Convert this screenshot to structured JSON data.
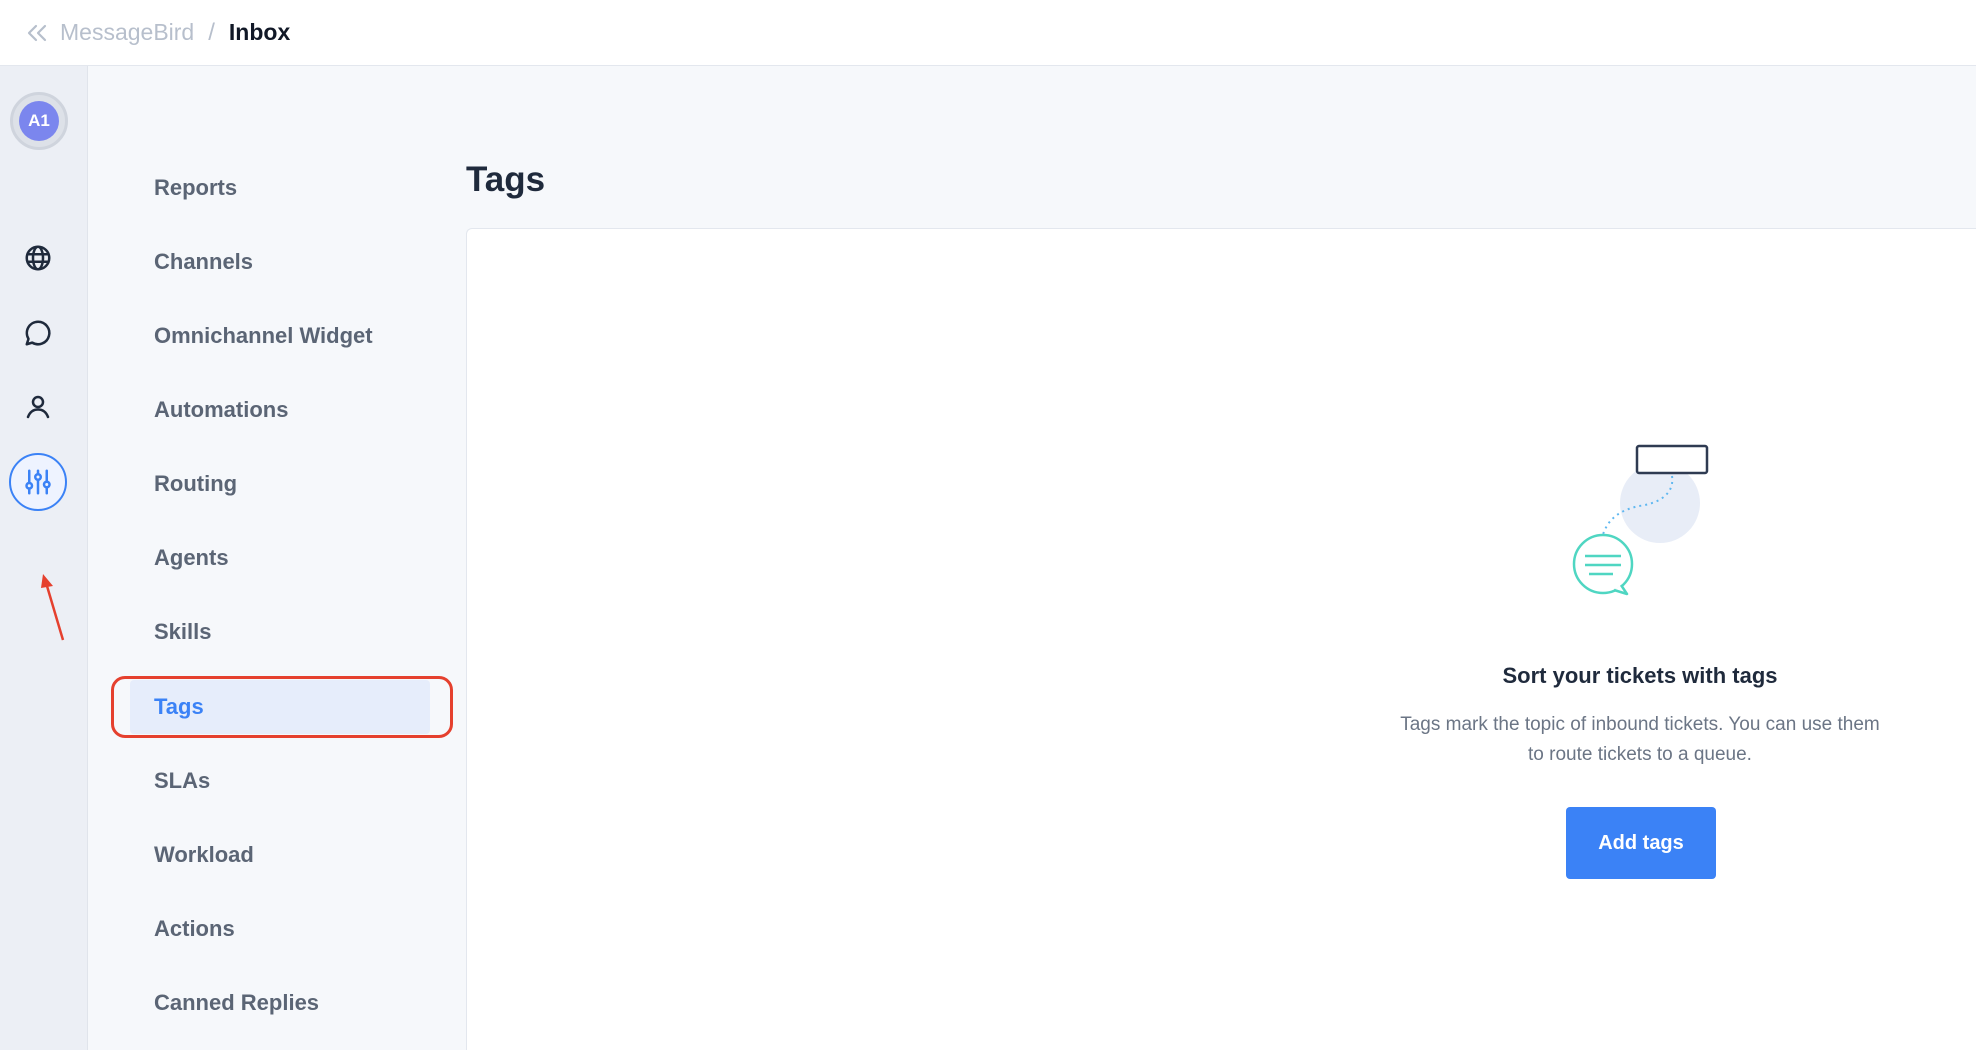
{
  "header": {
    "back_icon": "double-chevron-left-icon",
    "parent_crumb": "MessageBird",
    "separator": "/",
    "current_crumb": "Inbox"
  },
  "rail": {
    "avatar_initials": "A1",
    "items": [
      {
        "icon": "globe-icon"
      },
      {
        "icon": "chat-bubble-icon"
      },
      {
        "icon": "person-icon"
      },
      {
        "icon": "sliders-icon",
        "active": true
      }
    ]
  },
  "nav": {
    "items": [
      {
        "label": "Reports"
      },
      {
        "label": "Channels"
      },
      {
        "label": "Omnichannel Widget"
      },
      {
        "label": "Automations"
      },
      {
        "label": "Routing"
      },
      {
        "label": "Agents"
      },
      {
        "label": "Skills"
      },
      {
        "label": "Tags",
        "active": true
      },
      {
        "label": "SLAs"
      },
      {
        "label": "Workload"
      },
      {
        "label": "Actions"
      },
      {
        "label": "Canned Replies"
      }
    ]
  },
  "main": {
    "title": "Tags",
    "empty_state": {
      "illustration": "tag-chat-illustration",
      "heading": "Sort your tickets with tags",
      "description": "Tags mark the topic of inbound tickets. You can use them to route tickets to a queue.",
      "button_label": "Add tags"
    }
  },
  "colors": {
    "accent": "#3b82f6",
    "annotation": "#e5402e",
    "nav_active_bg": "#e6edfb"
  }
}
